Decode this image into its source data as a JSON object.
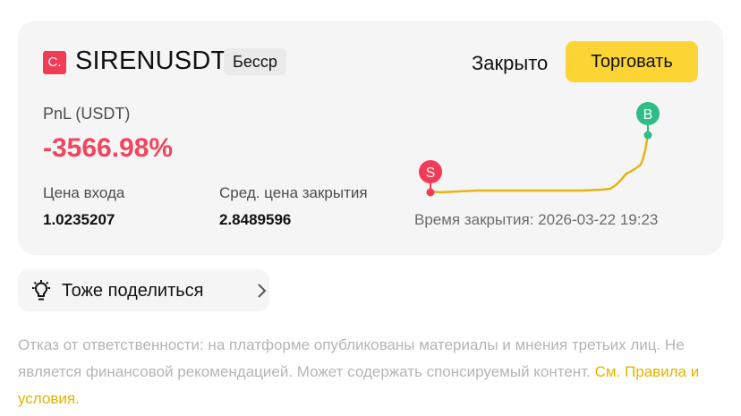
{
  "card": {
    "coin_icon": "C.",
    "symbol": "SIRENUSDT",
    "badge": "Бесср",
    "status": "Закрыто",
    "trade_button": "Торговать",
    "pnl_label": "PnL (USDT)",
    "pnl_value": "-3566.98%",
    "entry_label": "Цена входа",
    "entry_value": "1.0235207",
    "avg_close_label": "Сред. цена закрытия",
    "avg_close_value": "2.8489596",
    "close_time": "Время закрытия: 2026-03-22 19:23"
  },
  "chart": {
    "sell_marker": "S",
    "buy_marker": "B"
  },
  "share": {
    "label": "Тоже поделиться",
    "icon": "lightbulb-icon"
  },
  "disclaimer": {
    "text": "Отказ от ответственности: на платформе опубликованы материалы и мнения третьих лиц. Не является финансовой рекомендацией. Может содержать спонсируемый контент.",
    "link": "См. Правила и условия."
  },
  "colors": {
    "accent": "#fcd535",
    "negative": "#f0455e",
    "sell_marker": "#f23c55",
    "buy_marker": "#2ebd85",
    "line": "#e2b614",
    "link": "#e0b400"
  }
}
